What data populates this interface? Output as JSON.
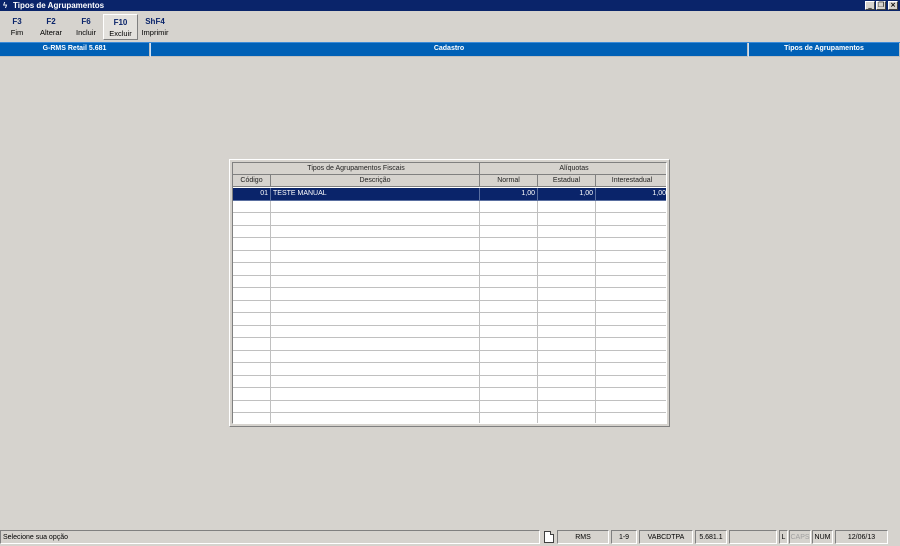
{
  "window": {
    "title": "Tipos de Agrupamentos",
    "icon": "lightning-icon",
    "controls": {
      "minimize": "_",
      "restore": "❐",
      "close": "×"
    }
  },
  "toolbar": [
    {
      "key": "F3",
      "label": "Fim"
    },
    {
      "key": "F2",
      "label": "Alterar"
    },
    {
      "key": "F6",
      "label": "Incluir"
    },
    {
      "key": "F10",
      "label": "Excluir"
    },
    {
      "key": "ShF4",
      "label": "Imprimir"
    }
  ],
  "header": {
    "app": "G-RMS Retail 5.681",
    "section": "Cadastro",
    "screen": "Tipos de Agrupamentos",
    "color": "#0060b6"
  },
  "grid": {
    "group_headers": {
      "fiscal": "Tipos de Agrupamentos Fiscais",
      "aliquotas": "Alíquotas"
    },
    "columns": {
      "codigo": "Código",
      "descricao": "Descrição",
      "normal": "Normal",
      "estadual": "Estadual",
      "interestadual": "Interestadual"
    },
    "rows": [
      {
        "codigo": "01",
        "descricao": "TESTE MANUAL",
        "normal": "1,00",
        "estadual": "1,00",
        "interestadual": "1,00"
      }
    ],
    "selection_color": "#0a246a"
  },
  "statusbar": {
    "message": "Selecione sua opção",
    "system": "RMS",
    "page": "1-9",
    "program": "VABCDTPA",
    "version": "5.681.1",
    "mode": "L",
    "caps": "CAPS",
    "num": "NUM",
    "date": "12/06/13"
  }
}
